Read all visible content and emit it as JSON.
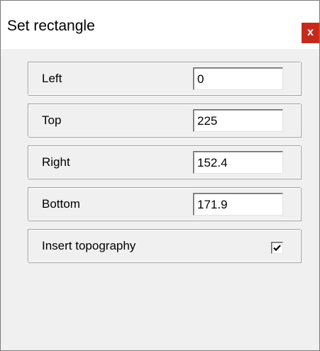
{
  "dialog": {
    "title": "Set rectangle",
    "close_label": "x"
  },
  "fields": [
    {
      "label": "Left",
      "value": "0"
    },
    {
      "label": "Top",
      "value": "225"
    },
    {
      "label": "Right",
      "value": "152.4"
    },
    {
      "label": "Bottom",
      "value": "171.9"
    }
  ],
  "insert_topography": {
    "label": "Insert topography",
    "checked": true
  },
  "colors": {
    "close_button": "#c42b1c",
    "dialog_background": "#f0f0f0"
  }
}
